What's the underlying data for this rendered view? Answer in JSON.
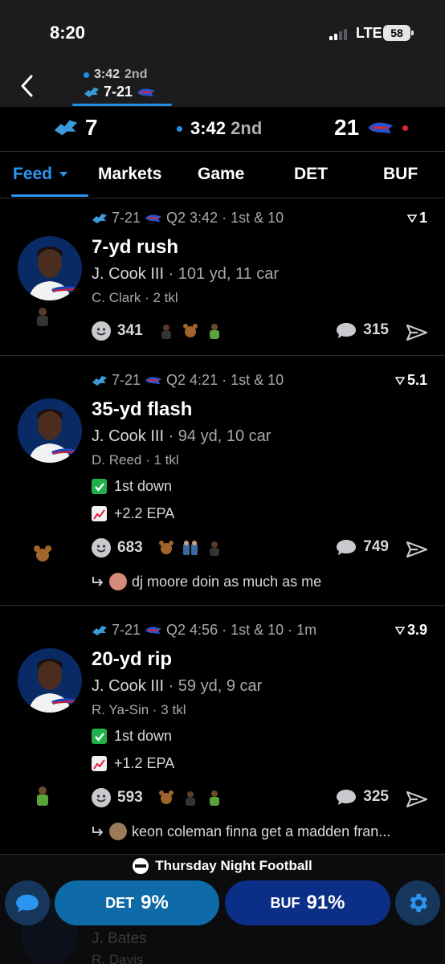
{
  "status": {
    "time": "8:20",
    "network": "LTE",
    "battery": "58"
  },
  "header": {
    "game_time": "3:42",
    "quarter": "2nd",
    "score": "7-21"
  },
  "scoreboard": {
    "home_score": "7",
    "clock": "3:42",
    "quarter": "2nd",
    "away_score": "21"
  },
  "tabs": [
    {
      "label": "Feed"
    },
    {
      "label": "Markets"
    },
    {
      "label": "Game"
    },
    {
      "label": "DET"
    },
    {
      "label": "BUF"
    }
  ],
  "feed": [
    {
      "score": "7-21",
      "situation": "Q2 3:42 · 1st & 10",
      "delta": "1",
      "play": "7-yd rush",
      "player": "J. Cook III",
      "player_stats": "· 101 yd, 11 car",
      "defender": "C. Clark · 2 tkl",
      "reactions": "341",
      "comments": "315"
    },
    {
      "score": "7-21",
      "situation": "Q2 4:21 · 1st & 10",
      "delta": "5.1",
      "play": "35-yd flash",
      "player": "J. Cook III",
      "player_stats": "· 94 yd, 10 car",
      "defender": "D. Reed · 1 tkl",
      "badge1": "1st down",
      "badge2": "+2.2 EPA",
      "reactions": "683",
      "comments": "749",
      "reply": "dj moore doin as much as me"
    },
    {
      "score": "7-21",
      "situation": "Q2 4:56 · 1st & 10 · 1m",
      "delta": "3.9",
      "play": "20-yd rip",
      "player": "J. Cook III",
      "player_stats": "· 59 yd, 9 car",
      "defender": "R. Ya-Sin · 3 tkl",
      "badge1": "1st down",
      "badge2": "+1.2 EPA",
      "reactions": "593",
      "comments": "325",
      "reply": "keon coleman finna get a madden fran..."
    }
  ],
  "ghost": {
    "line1": "J. Bates",
    "line2": "R. Davis"
  },
  "bottom": {
    "title": "Thursday Night Football",
    "det_label": "DET",
    "det_pct": "9%",
    "buf_label": "BUF",
    "buf_pct": "91%"
  },
  "colors": {
    "accent": "#2b95f2",
    "det_button": "#0f6aa8",
    "buf_button": "#0b2f86",
    "live_dot": "#e3242b"
  }
}
